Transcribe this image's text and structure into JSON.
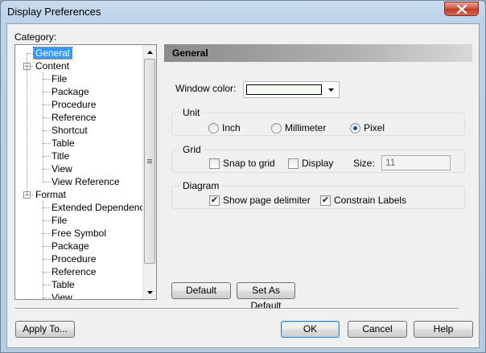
{
  "window": {
    "title": "Display Preferences"
  },
  "category": {
    "label": "Category:",
    "items": [
      {
        "label": "General",
        "level": 0,
        "selected": true
      },
      {
        "label": "Content",
        "level": 0,
        "expander": "−"
      },
      {
        "label": "File",
        "level": 1
      },
      {
        "label": "Package",
        "level": 1
      },
      {
        "label": "Procedure",
        "level": 1
      },
      {
        "label": "Reference",
        "level": 1
      },
      {
        "label": "Shortcut",
        "level": 1
      },
      {
        "label": "Table",
        "level": 1
      },
      {
        "label": "Title",
        "level": 1
      },
      {
        "label": "View",
        "level": 1
      },
      {
        "label": "View Reference",
        "level": 1
      },
      {
        "label": "Format",
        "level": 0,
        "expander": "−"
      },
      {
        "label": "Extended Dependency",
        "level": 1
      },
      {
        "label": "File",
        "level": 1
      },
      {
        "label": "Free Symbol",
        "level": 1
      },
      {
        "label": "Package",
        "level": 1
      },
      {
        "label": "Procedure",
        "level": 1
      },
      {
        "label": "Reference",
        "level": 1
      },
      {
        "label": "Table",
        "level": 1
      },
      {
        "label": "View",
        "level": 1
      }
    ]
  },
  "panel": {
    "header": "General",
    "window_color": {
      "label": "Window color:",
      "value": "#f3faf1"
    },
    "unit": {
      "title": "Unit",
      "options": [
        {
          "label": "Inch",
          "checked": false
        },
        {
          "label": "Millimeter",
          "checked": false
        },
        {
          "label": "Pixel",
          "checked": true
        }
      ]
    },
    "grid": {
      "title": "Grid",
      "snap_label": "Snap to grid",
      "snap_checked": false,
      "display_label": "Display",
      "display_checked": false,
      "size_label": "Size:",
      "size_value": "11"
    },
    "diagram": {
      "title": "Diagram",
      "show_delimiter_label": "Show page delimiter",
      "show_delimiter_checked": true,
      "constrain_labels_label": "Constrain Labels",
      "constrain_labels_checked": true
    },
    "default_button": "Default",
    "set_as_default_button": "Set As Default"
  },
  "footer": {
    "apply_to": "Apply To...",
    "ok": "OK",
    "cancel": "Cancel",
    "help": "Help"
  },
  "colors": {
    "selection": "#3399ff",
    "title_bar": "#bcd2e8",
    "close_button": "#c0392b"
  }
}
